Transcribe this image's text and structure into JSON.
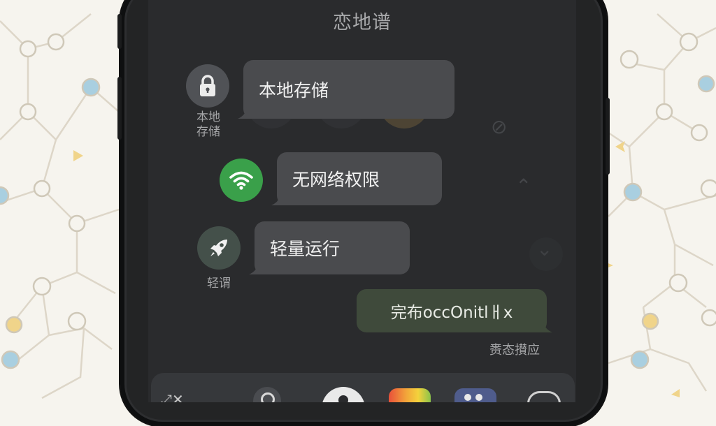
{
  "header": {
    "title": "恋地谱"
  },
  "messages": [
    {
      "text": "本地存储",
      "icon": "lock-icon",
      "caption": "本地\n存储",
      "icon_bg": "#505256"
    },
    {
      "text": "无网络权限",
      "icon": "wifi-icon",
      "caption": "",
      "icon_bg": "#3aa04a"
    },
    {
      "text": "轻量运行",
      "icon": "rocket-icon",
      "caption": "轻谓",
      "icon_bg": "#44504a"
    }
  ],
  "outgoing": {
    "text": "完布occOnitlㅐx",
    "status": "赉态攅应"
  },
  "dock": {
    "items": [
      "share-icon",
      "search-icon",
      "home-icon",
      "photos-icon",
      "apps-icon",
      "game-icon"
    ]
  },
  "colors": {
    "screen": "#2a2b2d",
    "bubble_in": "#4a4b4e",
    "bubble_out": "#3f4a3b",
    "wifi_green": "#3aa04a",
    "pattern_line": "#dcd5c6",
    "pattern_node": "#a9cfe0"
  }
}
